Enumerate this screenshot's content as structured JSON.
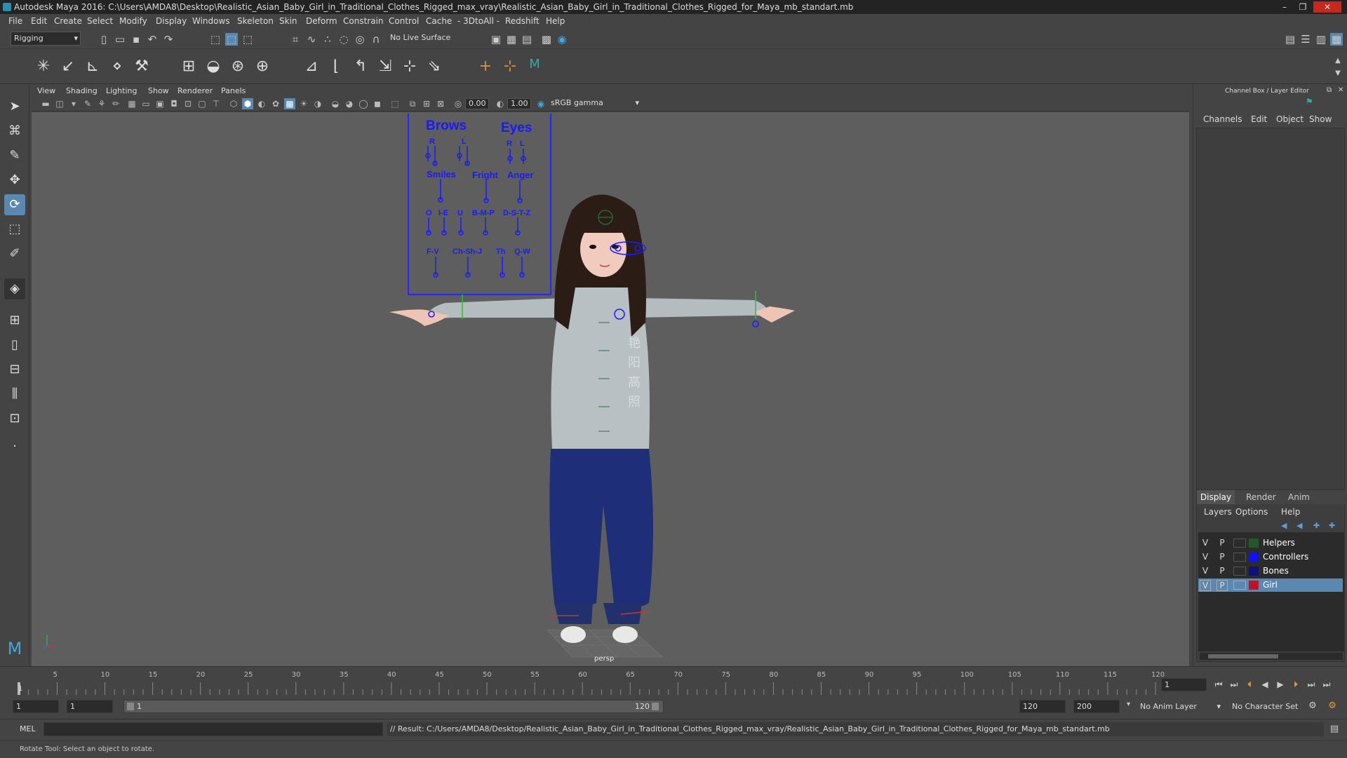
{
  "window": {
    "title": "Autodesk Maya 2016: C:\\Users\\AMDA8\\Desktop\\Realistic_Asian_Baby_Girl_in_Traditional_Clothes_Rigged_max_vray\\Realistic_Asian_Baby_Girl_in_Traditional_Clothes_Rigged_for_Maya_mb_standart.mb"
  },
  "menubar": [
    "File",
    "Edit",
    "Create",
    "Select",
    "Modify",
    "Display",
    "Windows",
    "Skeleton",
    "Skin",
    "Deform",
    "Constrain",
    "Control",
    "Cache",
    "- 3DtoAll -",
    "Redshift",
    "Help"
  ],
  "shelf": {
    "mode": "Rigging",
    "live_surface": "No Live Surface"
  },
  "viewport": {
    "menu": [
      "View",
      "Shading",
      "Lighting",
      "Show",
      "Renderer",
      "Panels"
    ],
    "exposure": "0.00",
    "gamma": "1.00",
    "color_space": "sRGB gamma",
    "camera_label": "persp"
  },
  "face_controls": {
    "brows": "Brows",
    "eyes": "Eyes",
    "r1": "R",
    "l1": "L",
    "r2": "R",
    "l2": "L",
    "smiles": "Smiles",
    "fright": "Fright",
    "anger": "Anger",
    "o": "O",
    "ie": "I-E",
    "u": "U",
    "bmp": "B-M-P",
    "dstz": "D-S-T-Z",
    "fv": "F-V",
    "chshj": "Ch-Sh-J",
    "th": "Th",
    "qw": "Q-W"
  },
  "shirt_text": [
    "艳",
    "阳",
    "高",
    "照"
  ],
  "right_panel": {
    "title": "Channel Box / Layer Editor",
    "menus": [
      "Channels",
      "Edit",
      "Object",
      "Show"
    ],
    "tabs": [
      "Display",
      "Render",
      "Anim"
    ],
    "layer_menus": [
      "Layers",
      "Options",
      "Help"
    ],
    "layers": [
      {
        "v": "V",
        "p": "P",
        "name": "Helpers",
        "color": "#1e5a2a",
        "selected": false
      },
      {
        "v": "V",
        "p": "P",
        "name": "Controllers",
        "color": "#1010ff",
        "selected": false
      },
      {
        "v": "V",
        "p": "P",
        "name": "Bones",
        "color": "#10107a",
        "selected": false
      },
      {
        "v": "V",
        "p": "P",
        "name": "Girl",
        "color": "#c0102a",
        "selected": true
      }
    ]
  },
  "timeline": {
    "ticks": [
      "5",
      "10",
      "15",
      "20",
      "25",
      "30",
      "35",
      "40",
      "45",
      "50",
      "55",
      "60",
      "65",
      "70",
      "75",
      "80",
      "85",
      "90",
      "95",
      "100",
      "105",
      "110",
      "115",
      "120"
    ],
    "start_tick": "1",
    "current_frame": "1"
  },
  "range": {
    "start": "1",
    "start2": "1",
    "slider_start": "1",
    "slider_end": "120",
    "end": "120",
    "end2": "200",
    "anim_layer": "No Anim Layer",
    "character_set": "No Character Set"
  },
  "command": {
    "lang": "MEL",
    "result": "// Result: C:/Users/AMDA8/Desktop/Realistic_Asian_Baby_Girl_in_Traditional_Clothes_Rigged_max_vray/Realistic_Asian_Baby_Girl_in_Traditional_Clothes_Rigged_for_Maya_mb_standart.mb"
  },
  "helpline": "Rotate Tool: Select an object to rotate."
}
